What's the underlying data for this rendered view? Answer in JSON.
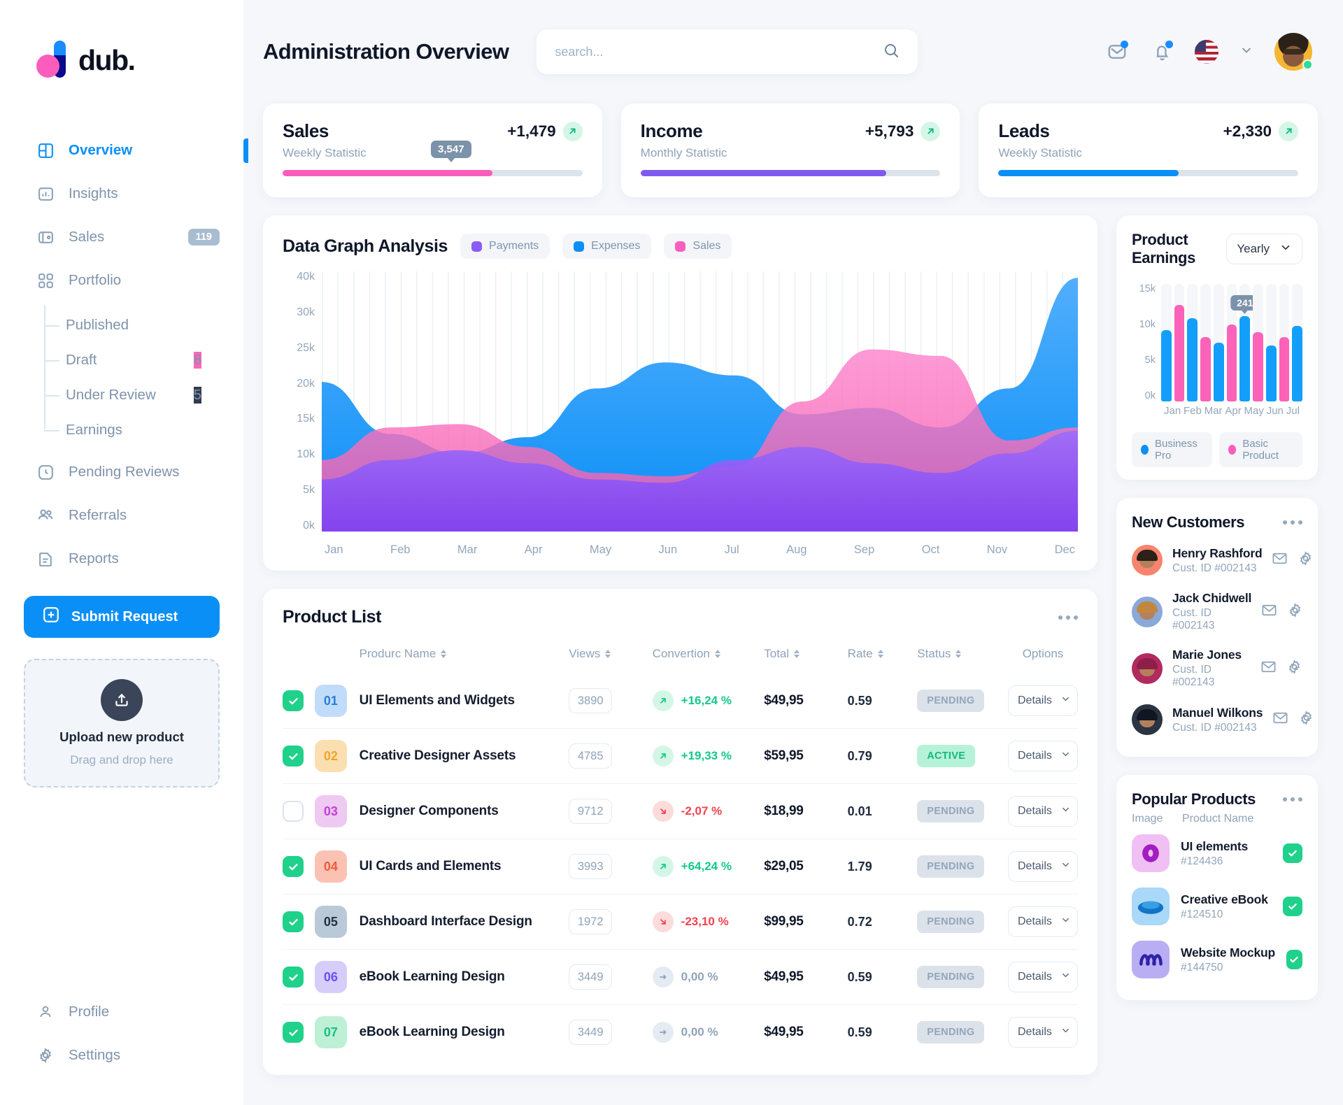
{
  "brand": {
    "name": "dub.",
    "logo_icon": "dub-logo"
  },
  "sidebar": {
    "nav": [
      {
        "label": "Overview",
        "icon": "dashboard-icon",
        "active": true
      },
      {
        "label": "Insights",
        "icon": "bar-chart-icon",
        "active": false
      },
      {
        "label": "Sales",
        "icon": "wallet-icon",
        "badge": "119",
        "active": false
      },
      {
        "label": "Portfolio",
        "icon": "grid-icon",
        "active": false
      }
    ],
    "subnav": [
      {
        "label": "Published"
      },
      {
        "label": "Draft",
        "badge": "8"
      },
      {
        "label": "Under Review",
        "badge": "5"
      },
      {
        "label": "Earnings"
      }
    ],
    "nav2": [
      {
        "label": "Pending Reviews",
        "icon": "clock-icon"
      },
      {
        "label": "Referrals",
        "icon": "users-icon"
      },
      {
        "label": "Reports",
        "icon": "document-icon"
      }
    ],
    "submit_label": "Submit Request",
    "upload": {
      "title": "Upload new product",
      "subtitle": "Drag and drop here",
      "icon": "upload-icon"
    },
    "bottom": [
      {
        "label": "Profile",
        "icon": "person-icon"
      },
      {
        "label": "Settings",
        "icon": "gear-icon"
      }
    ]
  },
  "header": {
    "title": "Administration Overview",
    "search_placeholder": "search...",
    "search_value": "",
    "mail_icon": "mail-check-icon",
    "bell_icon": "bell-icon",
    "flag_icon": "us-flag-icon",
    "chevron_icon": "chevron-down-icon",
    "avatar_icon": "user-avatar"
  },
  "stats": [
    {
      "name": "Sales",
      "subtitle": "Weekly Statistic",
      "delta": "+1,479",
      "tooltip": "3,547",
      "percent": 70,
      "color": "#fb5dbd"
    },
    {
      "name": "Income",
      "subtitle": "Monthly Statistic",
      "delta": "+5,793",
      "tooltip": "",
      "percent": 82,
      "color": "#7f5af0"
    },
    {
      "name": "Leads",
      "subtitle": "Weekly Statistic",
      "delta": "+2,330",
      "tooltip": "",
      "percent": 60,
      "color": "#0a8ff7"
    }
  ],
  "graph": {
    "title": "Data Graph Analysis",
    "legend": [
      {
        "label": "Payments",
        "color": "#8b5cf6"
      },
      {
        "label": "Expenses",
        "color": "#0a8ff7"
      },
      {
        "label": "Sales",
        "color": "#fb5dbd"
      }
    ]
  },
  "product_list": {
    "title": "Product List",
    "columns": [
      "",
      "",
      "Produrc Name",
      "Views",
      "Convertion",
      "Total",
      "Rate",
      "Status",
      "Options"
    ],
    "details_label": "Details",
    "rows": [
      {
        "checked": true,
        "num": "01",
        "num_bg": "#c1dcfb",
        "num_fg": "#2a7fd4",
        "name": "UI Elements and Widgets",
        "views": "3890",
        "conv": "+16,24 %",
        "dir": "up",
        "total": "$49,95",
        "rate": "0.59",
        "status": "PENDING"
      },
      {
        "checked": true,
        "num": "02",
        "num_bg": "#fbdfb0",
        "num_fg": "#f0a52c",
        "name": "Creative Designer Assets",
        "views": "4785",
        "conv": "+19,33 %",
        "dir": "up",
        "total": "$59,95",
        "rate": "0.79",
        "status": "ACTIVE"
      },
      {
        "checked": false,
        "num": "03",
        "num_bg": "#eec9f2",
        "num_fg": "#c13fd6",
        "name": "Designer Components",
        "views": "9712",
        "conv": "-2,07 %",
        "dir": "down",
        "total": "$18,99",
        "rate": "0.01",
        "status": "PENDING"
      },
      {
        "checked": true,
        "num": "04",
        "num_bg": "#fbc2b4",
        "num_fg": "#ed5b3a",
        "name": "UI Cards and Elements",
        "views": "3993",
        "conv": "+64,24 %",
        "dir": "up",
        "total": "$29,05",
        "rate": "1.79",
        "status": "PENDING"
      },
      {
        "checked": true,
        "num": "05",
        "num_bg": "#bac9d8",
        "num_fg": "#26303f",
        "name": "Dashboard Interface Design",
        "views": "1972",
        "conv": "-23,10 %",
        "dir": "down",
        "total": "$99,95",
        "rate": "0.72",
        "status": "PENDING"
      },
      {
        "checked": true,
        "num": "06",
        "num_bg": "#d6cdf9",
        "num_fg": "#6c4df0",
        "name": "eBook Learning Design",
        "views": "3449",
        "conv": "0,00 %",
        "dir": "flat",
        "total": "$49,95",
        "rate": "0.59",
        "status": "PENDING"
      },
      {
        "checked": true,
        "num": "07",
        "num_bg": "#bdf0d5",
        "num_fg": "#19c184",
        "name": "eBook Learning Design",
        "views": "3449",
        "conv": "0,00 %",
        "dir": "flat",
        "total": "$49,95",
        "rate": "0.59",
        "status": "PENDING"
      }
    ]
  },
  "product_earnings": {
    "title": "Product Earnings",
    "period": "Yearly",
    "tooltip": "241"
  },
  "new_customers": {
    "title": "New Customers",
    "items": [
      {
        "name": "Henry Rashford",
        "id": "Cust. ID #002143",
        "ring": "#f8836e",
        "hair": "#2b2118"
      },
      {
        "name": "Jack Chidwell",
        "id": "Cust. ID #002143",
        "ring": "#8aa8d8",
        "hair": "#c2873f"
      },
      {
        "name": "Marie Jones",
        "id": "Cust. ID #002143",
        "ring": "#b22a5e",
        "hair": "#8e1f48"
      },
      {
        "name": "Manuel Wilkons",
        "id": "Cust. ID #002143",
        "ring": "#2a3442",
        "hair": "#101722"
      }
    ]
  },
  "popular_products": {
    "title": "Popular Products",
    "col_image": "Image",
    "col_name": "Product Name",
    "items": [
      {
        "name": "UI elements",
        "id": "#124436",
        "bg": "#f0bff3",
        "shape": "#a21ec0"
      },
      {
        "name": "Creative eBook",
        "id": "#124510",
        "bg": "#a9d8f8",
        "shape": "#1374c7"
      },
      {
        "name": "Website Mockup",
        "id": "#144750",
        "bg": "#b9aef3",
        "shape": "#2e22a8"
      }
    ]
  },
  "chart_data": [
    {
      "type": "area",
      "title": "Data Graph Analysis",
      "x": [
        "Jan",
        "Feb",
        "Mar",
        "Apr",
        "May",
        "Jun",
        "Jul",
        "Aug",
        "Sep",
        "Oct",
        "Nov",
        "Dec"
      ],
      "ylabel": "",
      "xlabel": "",
      "yticks": [
        "0k",
        "5k",
        "10k",
        "15k",
        "20k",
        "25k",
        "30k",
        "40k"
      ],
      "ylim": [
        0,
        40000
      ],
      "grid": true,
      "legend_position": "top",
      "series": [
        {
          "name": "Expenses",
          "color": "#0a8ff7",
          "values": [
            23000,
            15000,
            12000,
            14500,
            22000,
            26000,
            24000,
            18000,
            19000,
            16000,
            22000,
            39000
          ]
        },
        {
          "name": "Sales",
          "color": "#fb5dbd",
          "values": [
            11000,
            16000,
            16500,
            13000,
            9000,
            8500,
            10000,
            20000,
            28000,
            27000,
            14000,
            16000
          ]
        },
        {
          "name": "Payments",
          "color": "#8b5cf6",
          "values": [
            8000,
            11000,
            12500,
            10500,
            8000,
            7500,
            11000,
            13000,
            10500,
            9000,
            12000,
            15500
          ]
        }
      ]
    },
    {
      "type": "bar",
      "title": "Product Earnings",
      "categories": [
        "Jan",
        "Jan",
        "Feb",
        "Feb",
        "Mar",
        "Mar",
        "Apr",
        "Apr",
        "May",
        "May",
        "Jun",
        "Jun"
      ],
      "xticks": [
        "Jan",
        "Feb",
        "Mar",
        "Apr",
        "May",
        "Jun",
        "Jul"
      ],
      "yticks": [
        "0k",
        "5k",
        "10k",
        "15k"
      ],
      "ylim": [
        0,
        16500
      ],
      "legend_position": "bottom",
      "annotation": "241",
      "series": [
        {
          "name": "Business Pro",
          "color": "#0a8ff7",
          "values": [
            10000,
            11700,
            8300,
            12000,
            7900,
            10600
          ]
        },
        {
          "name": "Basic Product",
          "color": "#fb5dbd",
          "values": [
            13600,
            9000,
            10800,
            9700,
            9000
          ]
        }
      ],
      "bars": [
        {
          "value": 10000,
          "series": "Business Pro"
        },
        {
          "value": 13600,
          "series": "Basic Product"
        },
        {
          "value": 11700,
          "series": "Business Pro"
        },
        {
          "value": 9000,
          "series": "Basic Product"
        },
        {
          "value": 8300,
          "series": "Business Pro"
        },
        {
          "value": 10800,
          "series": "Basic Product"
        },
        {
          "value": 12000,
          "series": "Business Pro",
          "label": "241"
        },
        {
          "value": 9700,
          "series": "Basic Product"
        },
        {
          "value": 7900,
          "series": "Business Pro"
        },
        {
          "value": 9000,
          "series": "Basic Product"
        },
        {
          "value": 10600,
          "series": "Business Pro"
        }
      ]
    }
  ]
}
